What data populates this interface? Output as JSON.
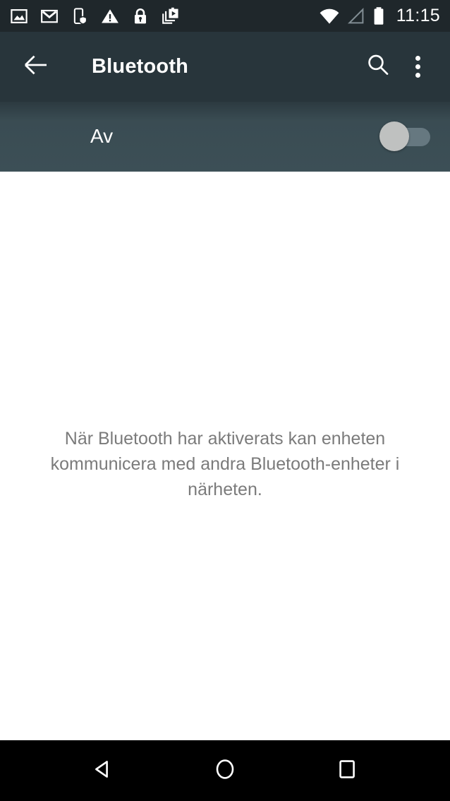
{
  "status_bar": {
    "background_color": "#1f272b",
    "clock": "11:15",
    "left_icons": [
      {
        "name": "image-icon",
        "label": "Screenshot saved"
      },
      {
        "name": "gmail-icon",
        "label": "Gmail"
      },
      {
        "name": "phone-shield-icon",
        "label": "Device protection"
      },
      {
        "name": "warning-icon",
        "label": "Warning"
      },
      {
        "name": "lock-icon",
        "label": "Secure"
      },
      {
        "name": "screen-record-icon",
        "label": "Screen recorder"
      }
    ],
    "right_icons": [
      {
        "name": "wifi-icon",
        "label": "Wi-Fi connected"
      },
      {
        "name": "cell-signal-icon",
        "label": "No cellular signal"
      },
      {
        "name": "battery-icon",
        "label": "Battery full"
      }
    ]
  },
  "action_bar": {
    "background_color": "#28353b",
    "title": "Bluetooth",
    "back_label": "Navigate up",
    "search_label": "Search",
    "overflow_label": "More options"
  },
  "switch_bar": {
    "background_color": "#3c4f56",
    "label": "Av",
    "state": "off",
    "thumb_color": "#bfc1c0",
    "track_color": "#667880"
  },
  "content": {
    "background_color": "#ffffff",
    "empty_message": "När Bluetooth har aktiverats kan enheten kommunicera med andra Bluetooth-enheter i närheten.",
    "text_color": "#7b7b7b"
  },
  "nav_bar": {
    "background_color": "#000000",
    "buttons": [
      {
        "name": "nav-back-button",
        "label": "Back"
      },
      {
        "name": "nav-home-button",
        "label": "Home"
      },
      {
        "name": "nav-recents-button",
        "label": "Recent apps"
      }
    ]
  }
}
